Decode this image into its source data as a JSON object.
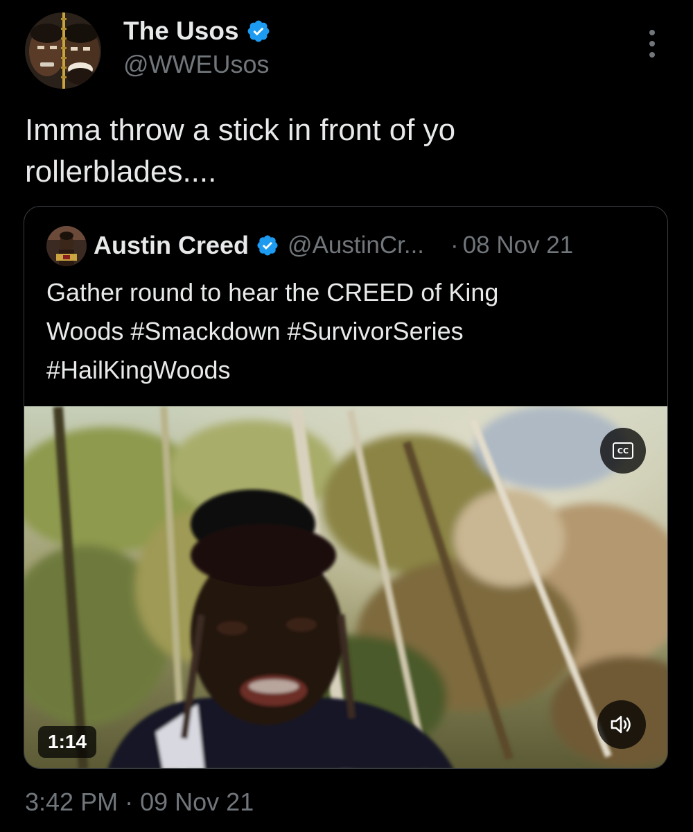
{
  "tweet": {
    "author_name": "The Usos",
    "author_handle": "@WWEUsos",
    "text": "Imma throw a stick in front of yo\nrollerblades....",
    "time": "3:42 PM",
    "separator": "·",
    "date": "09 Nov 21"
  },
  "quoted": {
    "author_name": "Austin Creed",
    "author_handle": "@AustinCr...",
    "separator": "·",
    "date": "08 Nov 21",
    "text": "Gather round to hear the CREED of King\nWoods #Smackdown #SurvivorSeries\n#HailKingWoods",
    "video": {
      "duration": "1:14",
      "cc_label": "CC"
    }
  },
  "icons": {
    "verified": "verified-badge-icon",
    "more": "more-vertical-icon",
    "captions": "closed-captions-icon",
    "volume": "volume-icon"
  },
  "colors": {
    "background": "#000000",
    "text_primary": "#e7e9ea",
    "text_secondary": "#71767b",
    "verified_blue": "#1d9bf0",
    "card_border": "#3a3d41"
  }
}
